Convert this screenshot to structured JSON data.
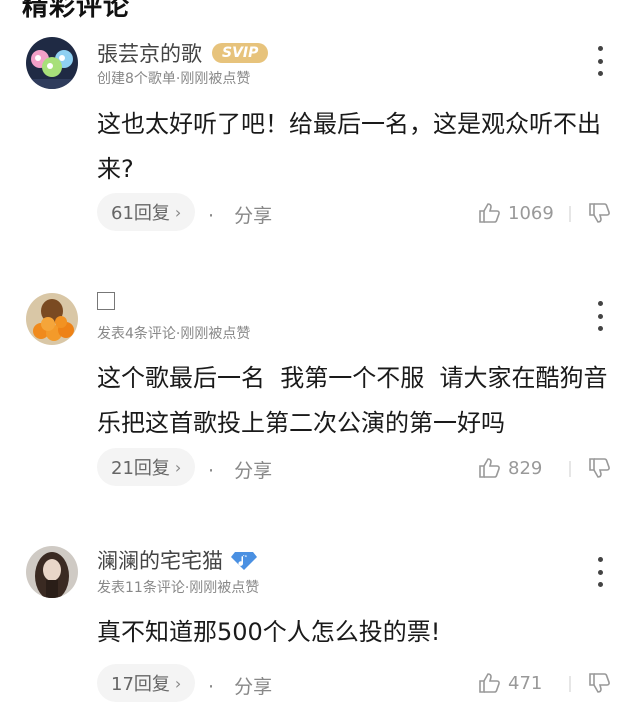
{
  "header": {
    "partial_title": "精彩评论"
  },
  "comments": [
    {
      "username": "張芸京的歌",
      "badge": "SVIP",
      "meta": "创建8个歌单·刚刚被点赞",
      "text": "这也太好听了吧！给最后一名，这是观众听不出来?",
      "reply_label": "61回复",
      "share_label": "分享",
      "likes": "1069"
    },
    {
      "username": "",
      "meta": "发表4条评论·刚刚被点赞",
      "text": "这个歌最后一名  我第一个不服  请大家在酷狗音乐把这首歌投上第二次公演的第一好吗",
      "reply_label": "21回复",
      "share_label": "分享",
      "likes": "829"
    },
    {
      "username": "澜澜的宅宅猫",
      "meta": "发表11条评论·刚刚被点赞",
      "text": "真不知道那500个人怎么投的票!",
      "reply_label": "17回复",
      "share_label": "分享",
      "likes": "471"
    }
  ],
  "colors": {
    "svip_badge": "#e7c37c",
    "verify_badge": "#4a90e2"
  }
}
